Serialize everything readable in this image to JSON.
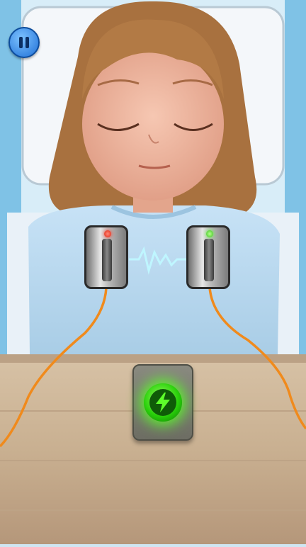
{
  "game": {
    "pause_button": {
      "icon": "pause-icon"
    },
    "electrodes": [
      {
        "id": "left-electrode",
        "led_color": "red"
      },
      {
        "id": "right-electrode",
        "led_color": "green"
      }
    ],
    "shock_button": {
      "icon": "lightning-bolt-icon",
      "state": "active"
    },
    "colors": {
      "wire": "#f08a1c",
      "heartbeat": "#bff6ff",
      "shock_glow": "#4cff2a"
    }
  }
}
